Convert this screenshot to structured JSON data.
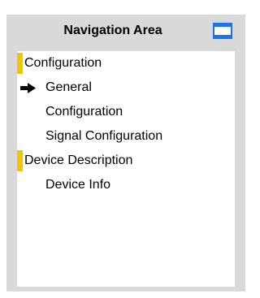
{
  "header": {
    "title": "Navigation Area",
    "window_icon": "window-icon"
  },
  "colors": {
    "panel_bg": "#d9d9d9",
    "section_marker": "#f5c400",
    "icon_blue": "#1a73e8"
  },
  "nav": {
    "items": [
      {
        "label": "Configuration",
        "level": 0,
        "type": "section"
      },
      {
        "label": "General",
        "level": 1,
        "type": "item",
        "selected": true,
        "icon": "arrow-right-icon"
      },
      {
        "label": "Configuration",
        "level": 1,
        "type": "item"
      },
      {
        "label": "Signal Configuration",
        "level": 1,
        "type": "item"
      },
      {
        "label": "Device Description",
        "level": 0,
        "type": "section"
      },
      {
        "label": "Device Info",
        "level": 1,
        "type": "item"
      }
    ]
  }
}
